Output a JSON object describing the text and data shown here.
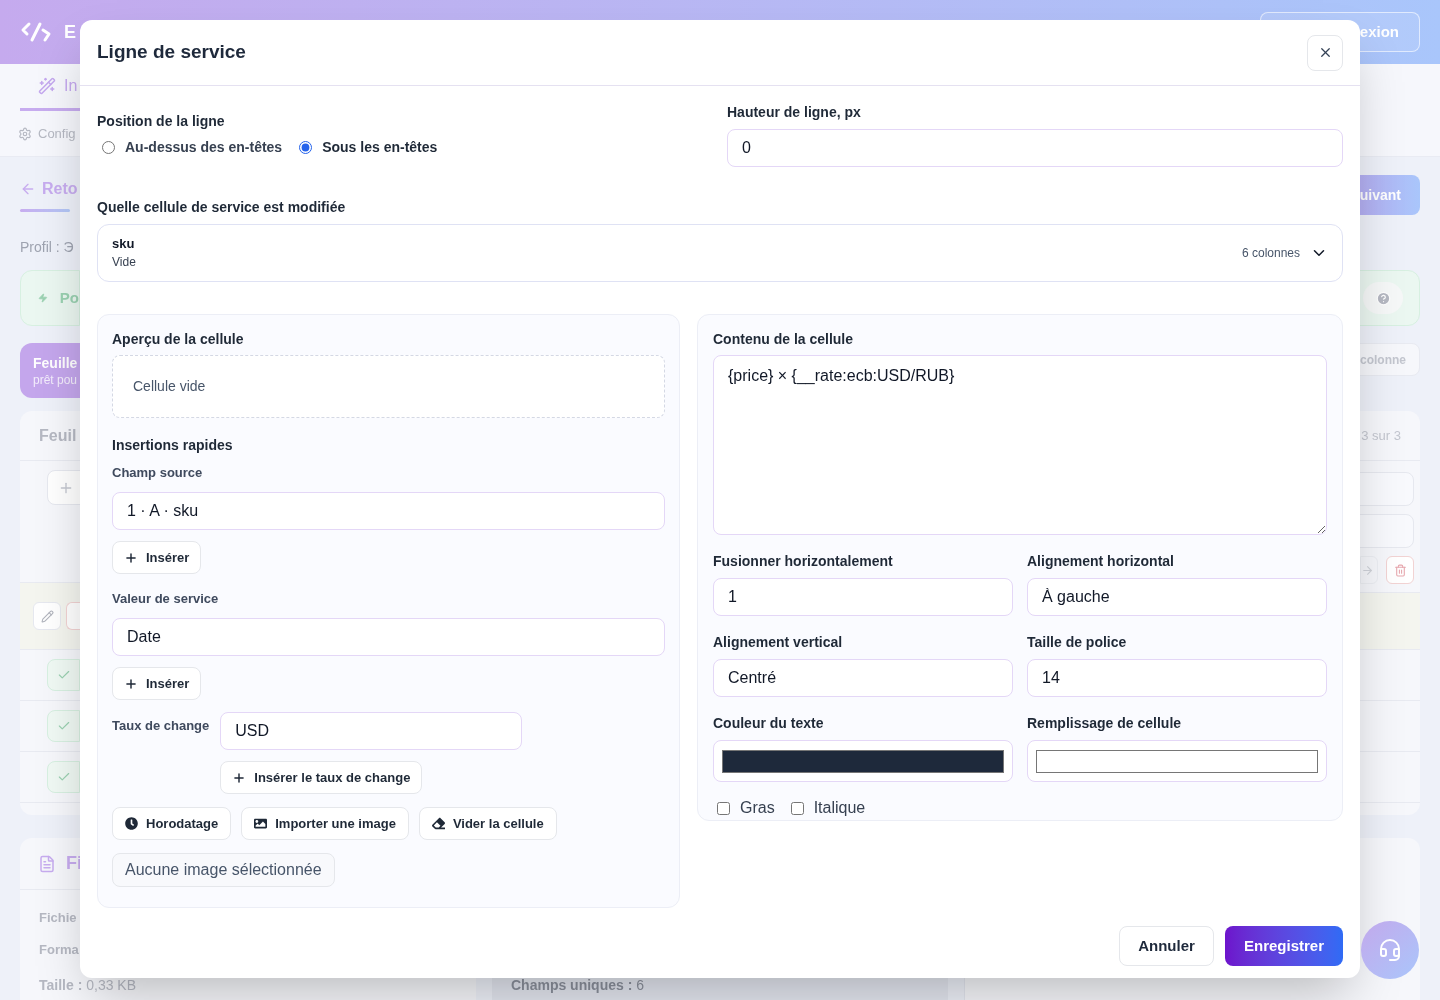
{
  "background": {
    "header": {
      "brand": "E",
      "login_button": "exion"
    },
    "nav": {
      "tab": {
        "label": "In",
        "selected": true
      },
      "settings_link": "Config"
    },
    "back_link": "Reto",
    "next_button": "uivant",
    "profile": "Profil : Э",
    "tip_card": {
      "text": "Po"
    },
    "sheet_card": {
      "title": "Feuille",
      "subtitle": "prêt pou"
    },
    "add_column_button": "colonne",
    "sheet_panel": {
      "title": "Feuil",
      "counter": "3 sur 3"
    },
    "file_card": {
      "title": "Fi",
      "rows": [
        "Fichie",
        "Forma"
      ],
      "size_label": "Taille :",
      "size_value": "0,33 KB"
    },
    "stats_card": {
      "label": "Champs uniques :",
      "value": "6"
    }
  },
  "dialog": {
    "title": "Ligne de service",
    "position": {
      "label": "Position de la ligne",
      "options": [
        {
          "label": "Au-dessus des en-têtes",
          "selected": false
        },
        {
          "label": "Sous les en-têtes",
          "selected": true
        }
      ]
    },
    "row_height": {
      "label": "Hauteur de ligne, px",
      "value": "0"
    },
    "cell_select": {
      "label": "Quelle cellule de service est modifiée",
      "name": "sku",
      "description": "Vide",
      "count": "6 colonnes"
    },
    "preview": {
      "title": "Aperçu de la cellule",
      "text": "Cellule vide"
    },
    "quick_inserts": {
      "title": "Insertions rapides",
      "source_field": {
        "label": "Champ source",
        "value": "1 · A · sku",
        "button": "Insérer"
      },
      "service_value": {
        "label": "Valeur de service",
        "value": "Date",
        "button": "Insérer"
      },
      "exchange_rate": {
        "label": "Taux de change",
        "value": "USD",
        "button": "Insérer le taux de change"
      },
      "actions": [
        {
          "kind": "clock",
          "label": "Horodatage"
        },
        {
          "kind": "image",
          "label": "Importer une image"
        },
        {
          "kind": "eraser",
          "label": "Vider la cellule"
        }
      ],
      "image_status": "Aucune image sélectionnée"
    },
    "content": {
      "label": "Contenu de la cellule",
      "value": "{price} × {__rate:ecb:USD/RUB}"
    },
    "fields": [
      {
        "kind": "text",
        "label": "Fusionner horizontalement",
        "value": "1"
      },
      {
        "kind": "text",
        "label": "Alignement horizontal",
        "value": "À gauche"
      },
      {
        "kind": "text",
        "label": "Alignement vertical",
        "value": "Centré"
      },
      {
        "kind": "text",
        "label": "Taille de police",
        "value": "14"
      },
      {
        "kind": "color",
        "label": "Couleur du texte",
        "color": "#1e293b"
      },
      {
        "kind": "color",
        "label": "Remplissage de cellule",
        "color": "#ffffff"
      }
    ],
    "styles": [
      {
        "label": "Gras",
        "checked": false
      },
      {
        "label": "Italique",
        "checked": false
      }
    ],
    "buttons": {
      "cancel": "Annuler",
      "save": "Enregistrer"
    }
  }
}
